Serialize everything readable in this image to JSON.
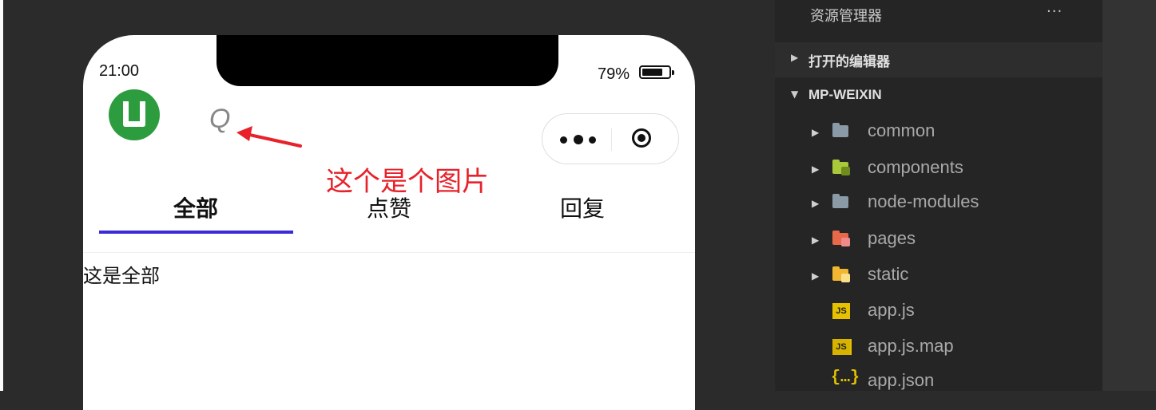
{
  "simulator": {
    "status_bar": {
      "time": "21:00",
      "battery_percent": "79%",
      "battery_level": 0.79
    },
    "header": {
      "search_image_glyph": "Q",
      "capsule": {
        "more_icon": "more-dots-icon",
        "close_icon": "target-circle-icon"
      }
    },
    "annotation": {
      "text": "这个是个图片",
      "color": "#e8212a"
    },
    "tabs": [
      {
        "label": "全部",
        "active": true
      },
      {
        "label": "点赞",
        "active": false
      },
      {
        "label": "回复",
        "active": false
      }
    ],
    "tab_indicator_color": "#3a2bd6",
    "content_text": "这是全部",
    "logo_color": "#2d9c3f"
  },
  "explorer": {
    "title": "资源管理器",
    "more": "···",
    "sections": [
      {
        "label": "打开的编辑器",
        "expanded": false
      },
      {
        "label": "MP-WEIXIN",
        "expanded": true
      }
    ],
    "tree": [
      {
        "name": "common",
        "type": "folder",
        "icon": "folder-icon",
        "color": "#8a9aa6"
      },
      {
        "name": "components",
        "type": "folder",
        "icon": "components-folder-icon",
        "color": "#a9c93b"
      },
      {
        "name": "node-modules",
        "type": "folder",
        "icon": "folder-icon",
        "color": "#8a9aa6"
      },
      {
        "name": "pages",
        "type": "folder",
        "icon": "pages-folder-icon",
        "color": "#e8694a"
      },
      {
        "name": "static",
        "type": "folder",
        "icon": "static-folder-icon",
        "color": "#f2b731"
      },
      {
        "name": "app.js",
        "type": "file",
        "icon": "js-file-icon"
      },
      {
        "name": "app.js.map",
        "type": "file",
        "icon": "js-map-file-icon"
      },
      {
        "name": "app.json",
        "type": "file",
        "icon": "json-file-icon"
      }
    ]
  }
}
